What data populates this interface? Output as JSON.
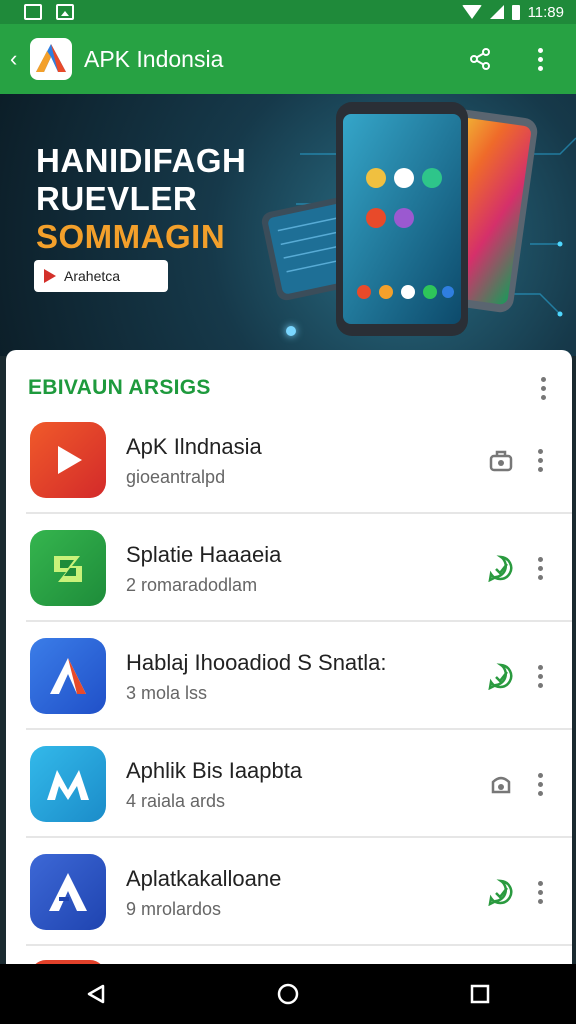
{
  "status_bar": {
    "time": "11:89"
  },
  "app_bar": {
    "title": "APK Indonsia",
    "back_icon": "chevron-left-icon",
    "share_icon": "share-icon",
    "more_icon": "more-vert-icon"
  },
  "banner": {
    "line1": "HANIDIFAGH",
    "line2": "RUEVLER",
    "line3": "SOMMAGIN",
    "button_label": "Arahetca"
  },
  "section": {
    "title": "EBIVAUN ARSIGS"
  },
  "apps": [
    {
      "name": "ApK Ilndnasia",
      "sub": "gioeantralpd",
      "action_icon": "download-icon",
      "icon_color": "#e2412a"
    },
    {
      "name": "Splatie Haaaeia",
      "sub": "2 romaradodlam",
      "action_icon": "check-download-icon",
      "icon_color": "#2aa44a"
    },
    {
      "name": "Hablaj Ihooadiod S Snatla:",
      "sub": "3 mola lss",
      "action_icon": "check-download-icon",
      "icon_color": "#2f6fdf"
    },
    {
      "name": "Aphlik Bis Iaapbta",
      "sub": "4 raiala ards",
      "action_icon": "download-icon",
      "icon_color": "#1aa0d8"
    },
    {
      "name": "Aplatkakalloane",
      "sub": "9 mrolardos",
      "action_icon": "check-download-icon",
      "icon_color": "#2f5fc9"
    }
  ],
  "colors": {
    "primary": "#27a243",
    "accent": "#f3a02b"
  }
}
